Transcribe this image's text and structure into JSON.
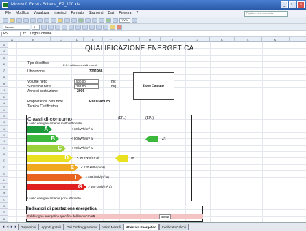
{
  "window": {
    "title": "Microsoft Excel - Scheda_EP_100.xls"
  },
  "menu": [
    "File",
    "Modifica",
    "Visualizza",
    "Inserisci",
    "Formato",
    "Strumenti",
    "Dati",
    "Finestra",
    "?"
  ],
  "help_placeholder": "Digitare una domanda",
  "toolbar": {
    "zoom": "100%",
    "font": "Tahoma",
    "size": "8"
  },
  "formula": {
    "cell": "F5",
    "fx": "fx",
    "content": "Logo Comune"
  },
  "columns": [
    "A",
    "B",
    "C",
    "D",
    "E",
    "F",
    "G",
    "H",
    "I",
    "J",
    "K",
    "L",
    "M"
  ],
  "rows": [
    "3",
    "4",
    "5",
    "6",
    "7",
    "8",
    "9",
    "10",
    "11",
    "12",
    "13",
    "14",
    "15",
    "16",
    "17",
    "18",
    "19",
    "20",
    "21",
    "22",
    "23",
    "24",
    "25",
    "26",
    "27",
    "28",
    "29",
    "30"
  ],
  "doc": {
    "title": "QUALIFICAZIONE ENERGETICA",
    "tipo_label": "Tipo di edificio",
    "tipo_value": "E.1.1 Abitazioni civili e rurali",
    "ubicazione_label": "Ubicazione",
    "ubicazione_value": "3201986",
    "volume_label": "Volume netto",
    "volume_value": "500,00",
    "volume_unit": "mc",
    "superficie_label": "Superficie netta",
    "superficie_value": "152,00",
    "superficie_unit": "mq",
    "anno_label": "Anno di costruzione",
    "anno_value": "2006",
    "proprietario_label": "Proprietario/Costruttore",
    "proprietario_value": "Rossi Arturo",
    "tecnico_label": "Tecnico Certificatore",
    "logo": "Logo Comune",
    "classi_title": "Classi di consumo",
    "ep_label": "(EPₕ)",
    "ep2_label": "(EPₕ)",
    "top_note": "Livello energeticamente molto efficiente",
    "bottom_note": "Livello energeticamente poco efficiente",
    "classes": [
      {
        "letter": "A",
        "text": "< 30 kWh/(m² a)",
        "color": "#1a9a3a"
      },
      {
        "letter": "B",
        "text": "< 50 kWh/(m² a)",
        "color": "#3cb83c"
      },
      {
        "letter": "C",
        "text": "< 70 kWh/(m² a)",
        "color": "#9bd23c"
      },
      {
        "letter": "D",
        "text": "< 90 kWh/(m² a)",
        "color": "#e8e020"
      },
      {
        "letter": "E",
        "text": "< 120 kWh/(m² a)",
        "color": "#f0a820"
      },
      {
        "letter": "F",
        "text": "< 160 kWh/(m² a)",
        "color": "#e86420"
      },
      {
        "letter": "G",
        "text": "> 160 kWh/(m² a)",
        "color": "#e02020"
      }
    ],
    "pointer_yellow_value": "78",
    "pointer_green_value": "43",
    "indicatori_title": "Indicatori di prestazione energetica",
    "indicatori_row": "Fabbisogno energetico specifico dell'involucro AR",
    "indicatori_value": "33,52"
  },
  "tabs": [
    "Dispersioni",
    "Apporti gratuiti",
    "Dati Ombreggiamento",
    "Valori Mensili",
    "Attestato Energetico",
    "Certificato Calcoli"
  ],
  "active_tab": "Attestato Energetico"
}
